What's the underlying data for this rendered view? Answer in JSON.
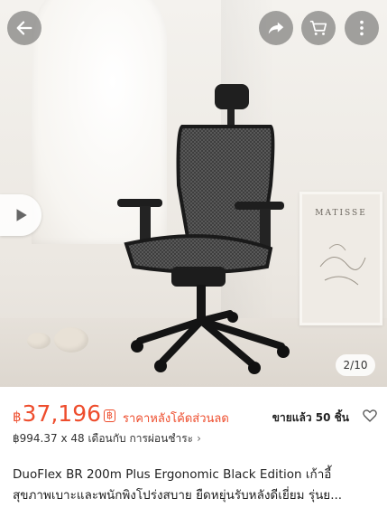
{
  "gallery": {
    "counter": "2/10",
    "artwork_title": "MATISSE",
    "icons": {
      "back": "arrow-left-icon",
      "share": "share-icon",
      "cart": "cart-icon",
      "more": "more-vertical-icon",
      "play": "play-icon"
    }
  },
  "product": {
    "currency": "฿",
    "price": "37,196",
    "coin_badge": "฿",
    "price_note": "ราคาหลังโค้ดส่วนลด",
    "sold": "ขายแล้ว 50 ชิ้น",
    "installment": "฿994.37 x 48 เดือนกับ การผ่อนชำระ",
    "title_line1": "DuoFlex BR 200m Plus Ergonomic Black Edition  เก้าอี้",
    "title_line2": "สุขภาพเบาะและพนักพิงโปร่งสบาย ยืดหยุ่นรับหลังดีเยี่ยม รุ่นย..."
  },
  "colors": {
    "accent": "#ee4d2d"
  }
}
